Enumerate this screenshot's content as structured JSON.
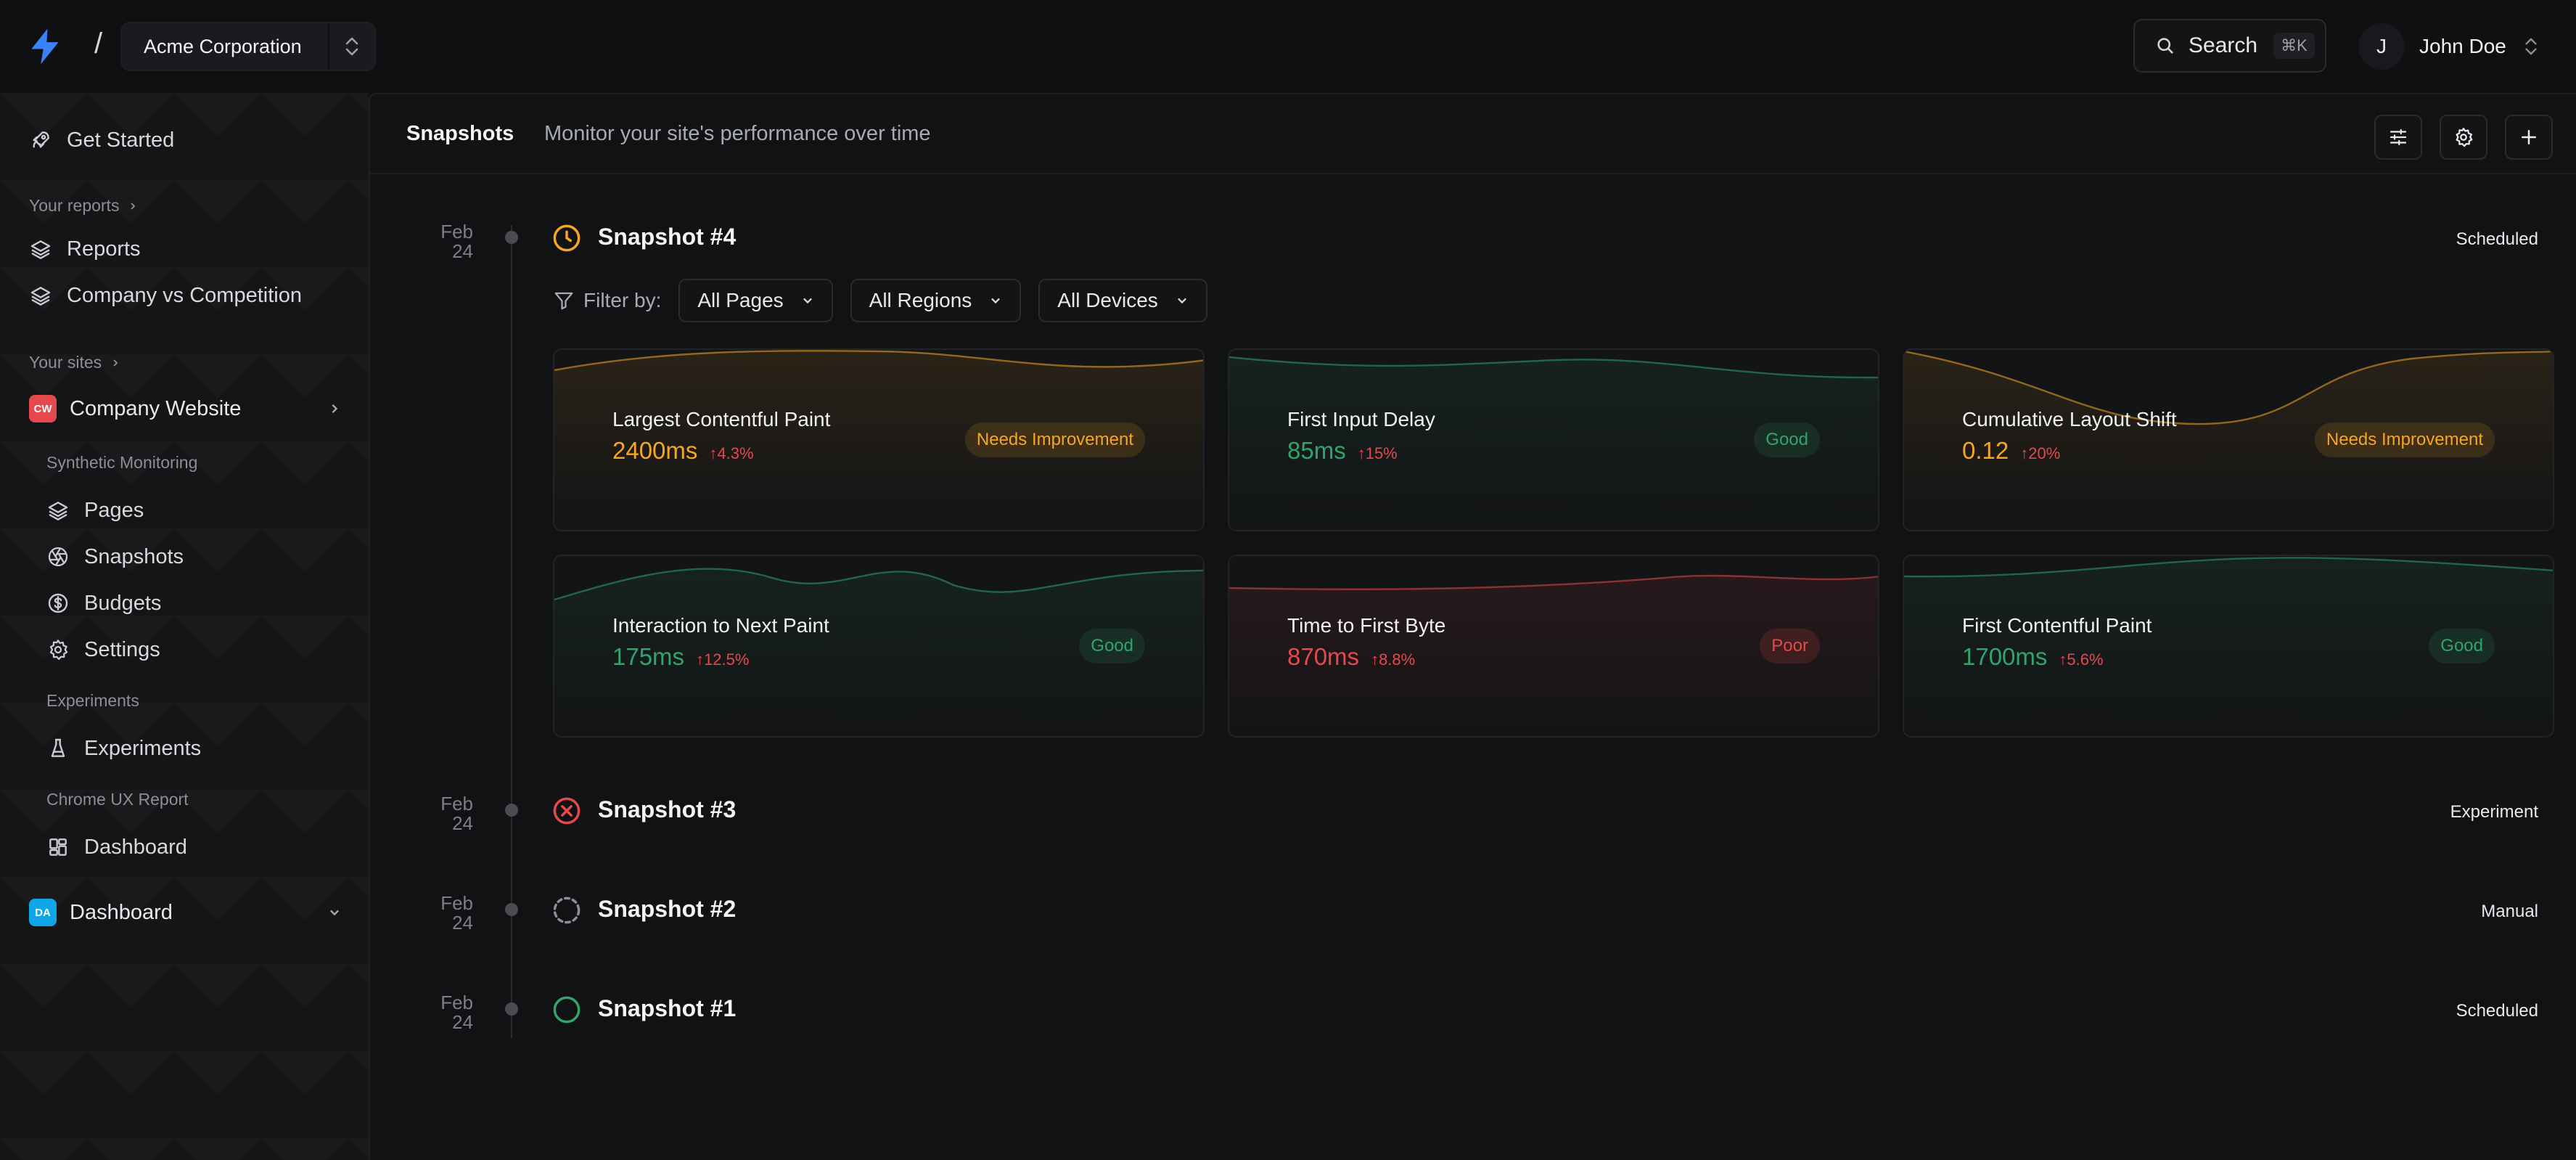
{
  "colors": {
    "accent": "#3b82f6",
    "good": "#30a46c",
    "warn": "#f5a623",
    "poor": "#e5484d",
    "background": "#0f1012"
  },
  "topbar": {
    "logo_icon": "bolt-icon",
    "separator": "/",
    "org_name": "Acme Corporation",
    "search_label": "Search",
    "search_shortcut": "⌘K",
    "user_initial": "J",
    "user_name": "John Doe"
  },
  "sidebar": {
    "get_started": "Get Started",
    "reports_section": "Your reports",
    "reports": [
      "Reports",
      "Company vs Competition"
    ],
    "sites_section": "Your sites",
    "site": {
      "initials": "CW",
      "name": "Company Website",
      "color": "#e5484d"
    },
    "synthetic_section": "Synthetic Monitoring",
    "synthetic_items": [
      "Pages",
      "Snapshots",
      "Budgets",
      "Settings"
    ],
    "experiments_section": "Experiments",
    "experiments_item": "Experiments",
    "crux_section": "Chrome UX Report",
    "crux_item": "Dashboard",
    "site2": {
      "initials": "DA",
      "name": "Dashboard",
      "color": "#0ea5e9"
    }
  },
  "main": {
    "title": "Snapshots",
    "description": "Monitor your site's performance over time",
    "filter_label": "Filter by:",
    "filters": [
      "All Pages",
      "All Regions",
      "All Devices"
    ],
    "snapshots": [
      {
        "month": "Feb",
        "day": "24",
        "title": "Snapshot #4",
        "tag": "Scheduled",
        "status": "scheduled"
      },
      {
        "month": "Feb",
        "day": "24",
        "title": "Snapshot #3",
        "tag": "Experiment",
        "status": "failed"
      },
      {
        "month": "Feb",
        "day": "24",
        "title": "Snapshot #2",
        "tag": "Manual",
        "status": "running"
      },
      {
        "month": "Feb",
        "day": "24",
        "title": "Snapshot #1",
        "tag": "Scheduled",
        "status": "complete"
      }
    ],
    "metrics": [
      {
        "name": "Largest Contentful Paint",
        "value": "2400ms",
        "delta": "4.3%",
        "badge": "Needs Improvement",
        "status": "warn"
      },
      {
        "name": "First Input Delay",
        "value": "85ms",
        "delta": "15%",
        "badge": "Good",
        "status": "good"
      },
      {
        "name": "Cumulative Layout Shift",
        "value": "0.12",
        "delta": "20%",
        "badge": "Needs Improvement",
        "status": "warn"
      },
      {
        "name": "Interaction to Next Paint",
        "value": "175ms",
        "delta": "12.5%",
        "badge": "Good",
        "status": "good"
      },
      {
        "name": "Time to First Byte",
        "value": "870ms",
        "delta": "8.8%",
        "badge": "Poor",
        "status": "poor"
      },
      {
        "name": "First Contentful Paint",
        "value": "1700ms",
        "delta": "5.6%",
        "badge": "Good",
        "status": "good"
      }
    ]
  }
}
